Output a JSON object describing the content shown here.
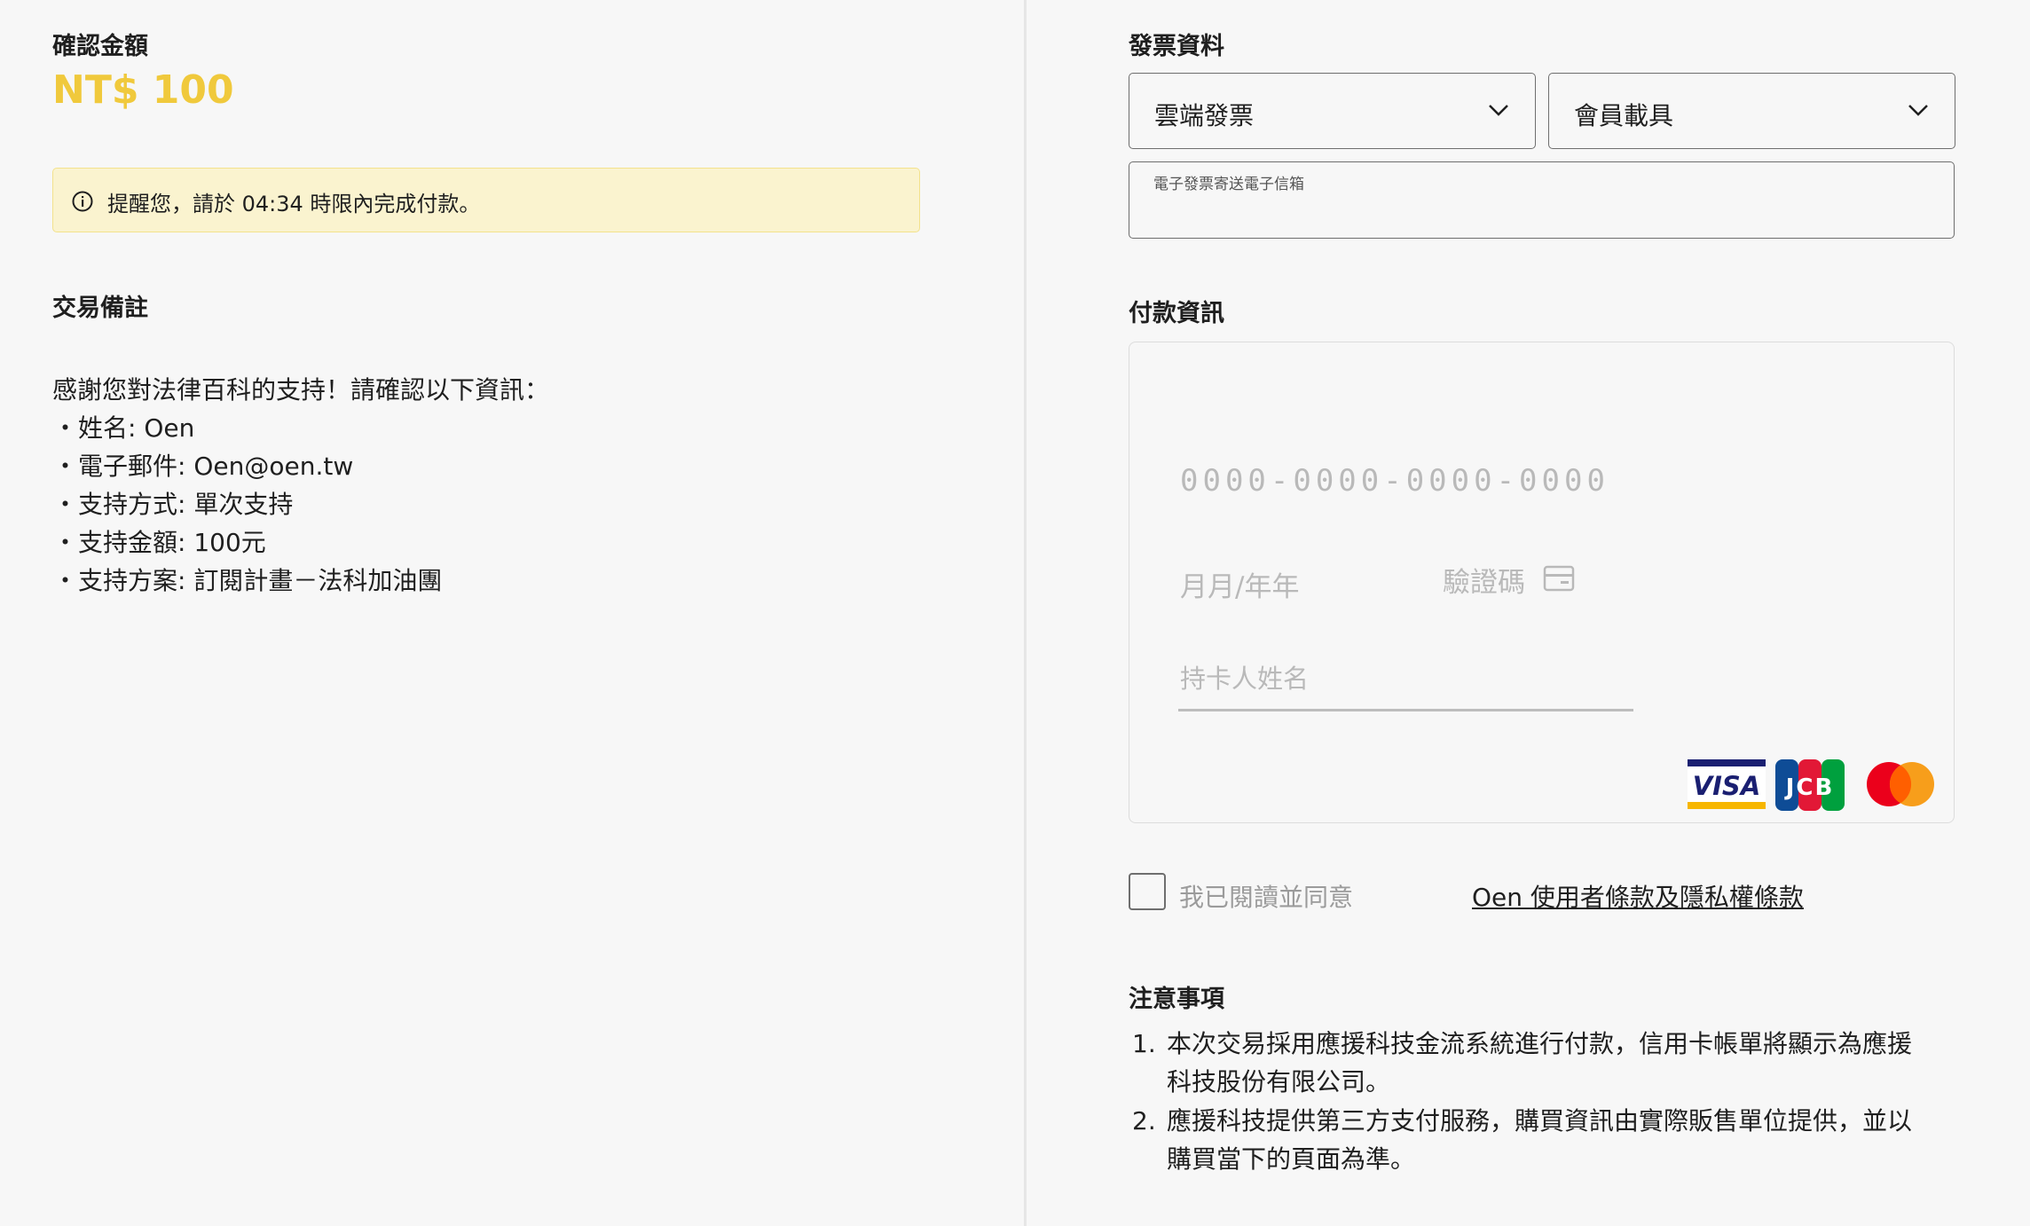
{
  "left": {
    "confirm_title": "確認金額",
    "amount": "NT$ 100",
    "notice": "提醒您，請於 04:34 時限內完成付款。",
    "memo_title": "交易備註",
    "memo_lines": [
      "感謝您對法律百科的支持！請確認以下資訊：",
      "姓名: Oen",
      "電子郵件: Oen@oen.tw",
      "支持方式: 單次支持",
      "支持金額: 100元",
      "支持方案: 訂閱計畫－法科加油團"
    ],
    "bullet": "・"
  },
  "invoice": {
    "title": "發票資料",
    "type_select": "雲端發票",
    "carrier_select": "會員載具",
    "email_label": "電子發票寄送電子信箱",
    "email_value": ""
  },
  "payment": {
    "title": "付款資訊",
    "card_number_placeholder": "0000-0000-0000-0000",
    "expiry_placeholder": "月月/年年",
    "cvc_placeholder": "驗證碼",
    "holder_placeholder": "持卡人姓名",
    "brands": [
      "VISA",
      "JCB",
      "Mastercard"
    ]
  },
  "terms": {
    "checked": false,
    "prefix": "我已閱讀並同意",
    "link": "Oen 使用者條款及隱私權條款"
  },
  "notes": {
    "title": "注意事項",
    "items": [
      {
        "num": "1.",
        "text": "本次交易採用應援科技金流系統進行付款，信用卡帳單將顯示為應援科技股份有限公司。"
      },
      {
        "num": "2.",
        "text": "應援科技提供第三方支付服務，購買資訊由實際販售單位提供，並以購買當下的頁面為準。"
      }
    ]
  },
  "colors": {
    "accent": "#f0c93c",
    "notice_bg": "#faf3cf",
    "visa_blue": "#1a1f71",
    "visa_gold": "#f7b600",
    "mc_red": "#eb001b",
    "mc_orange": "#f79e1b"
  }
}
